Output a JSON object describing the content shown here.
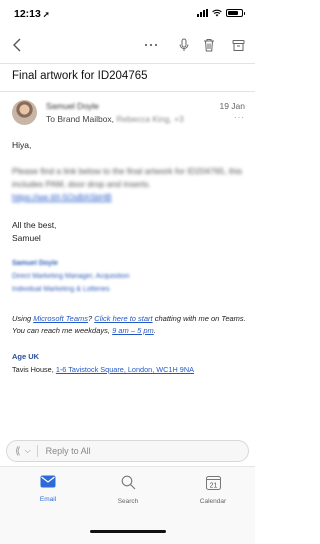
{
  "status_bar": {
    "time": "12:13",
    "location_icon": "location-arrow-icon",
    "battery_level": 0.8
  },
  "toolbar": {
    "back_icon": "chevron-left-icon",
    "more_icon": "ellipsis-icon",
    "mic_icon": "microphone-icon",
    "delete_icon": "trash-icon",
    "archive_icon": "archive-icon"
  },
  "email": {
    "subject": "Final artwork for ID204765",
    "sender": "Samuel Doyle",
    "date": "19 Jan",
    "to_prefix": "To Brand Mailbox,",
    "to_others": "Rebecca King, +3",
    "more": "···",
    "greeting": "Hiya,",
    "para1": "Please find a link below to the final artwork for ID204765, this includes PAM, door drop and inserts.",
    "link1": "https://we.tl/t-5OsBASbHB",
    "closing1": "All the best,",
    "closing2": "Samuel",
    "sig_name": "Samuel Doyle",
    "sig_title": "Direct Marketing Manager, Acquisition",
    "sig_dept": "Individual Marketing & Lotteries",
    "teams_part1": "Using ",
    "teams_link": "Microsoft Teams",
    "teams_part2": "? ",
    "teams_link2": "Click here to start",
    "teams_part3": " chatting with me on Teams. You can reach me weekdays, ",
    "teams_hours": "9 am – 5 pm",
    "teams_part4": ".",
    "org": "Age UK",
    "address_prefix": "Tavis House, ",
    "address_link": "1-6 Tavistock Square, London, WC1H 9NA"
  },
  "reply": {
    "label": "Reply to All"
  },
  "tabs": [
    {
      "label": "Email",
      "icon": "mail-icon",
      "active": true,
      "color": "#2f6bd6"
    },
    {
      "label": "Search",
      "icon": "search-icon",
      "active": false
    },
    {
      "label": "Calendar",
      "icon": "calendar-icon",
      "active": false,
      "day": "21"
    }
  ]
}
